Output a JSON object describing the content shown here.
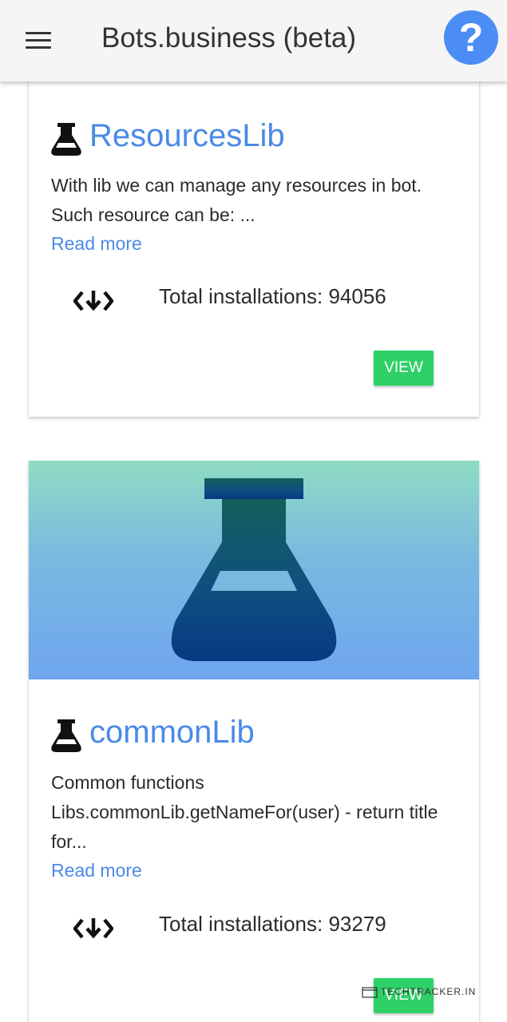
{
  "header": {
    "title": "Bots.business (beta)",
    "help_label": "?",
    "menu_icon": "hamburger-menu-icon",
    "help_icon": "help-circle-icon",
    "help_color": "#4c8df5"
  },
  "libs": [
    {
      "icon": "flask-icon",
      "name": "ResourcesLib",
      "description": "With lib we can manage any resources in bot. Such resource can be: ...",
      "read_more": "Read more",
      "installs_icon": "install-code-icon",
      "installations": "Total installations: 94056",
      "view_label": "VIEW"
    },
    {
      "icon": "flask-icon",
      "image_icon": "flask-image-icon",
      "name": "commonLib",
      "description": "Common functions Libs.commonLib.getNameFor(user) - return title for...",
      "read_more": "Read more",
      "installs_icon": "install-code-icon",
      "installations": "Total installations: 93279",
      "view_label": "VIEW"
    }
  ],
  "colors": {
    "link": "#4a8ae6",
    "button": "#2ed167",
    "flask": "#0e3a78"
  },
  "watermark": "TECHTRACKER.IN"
}
